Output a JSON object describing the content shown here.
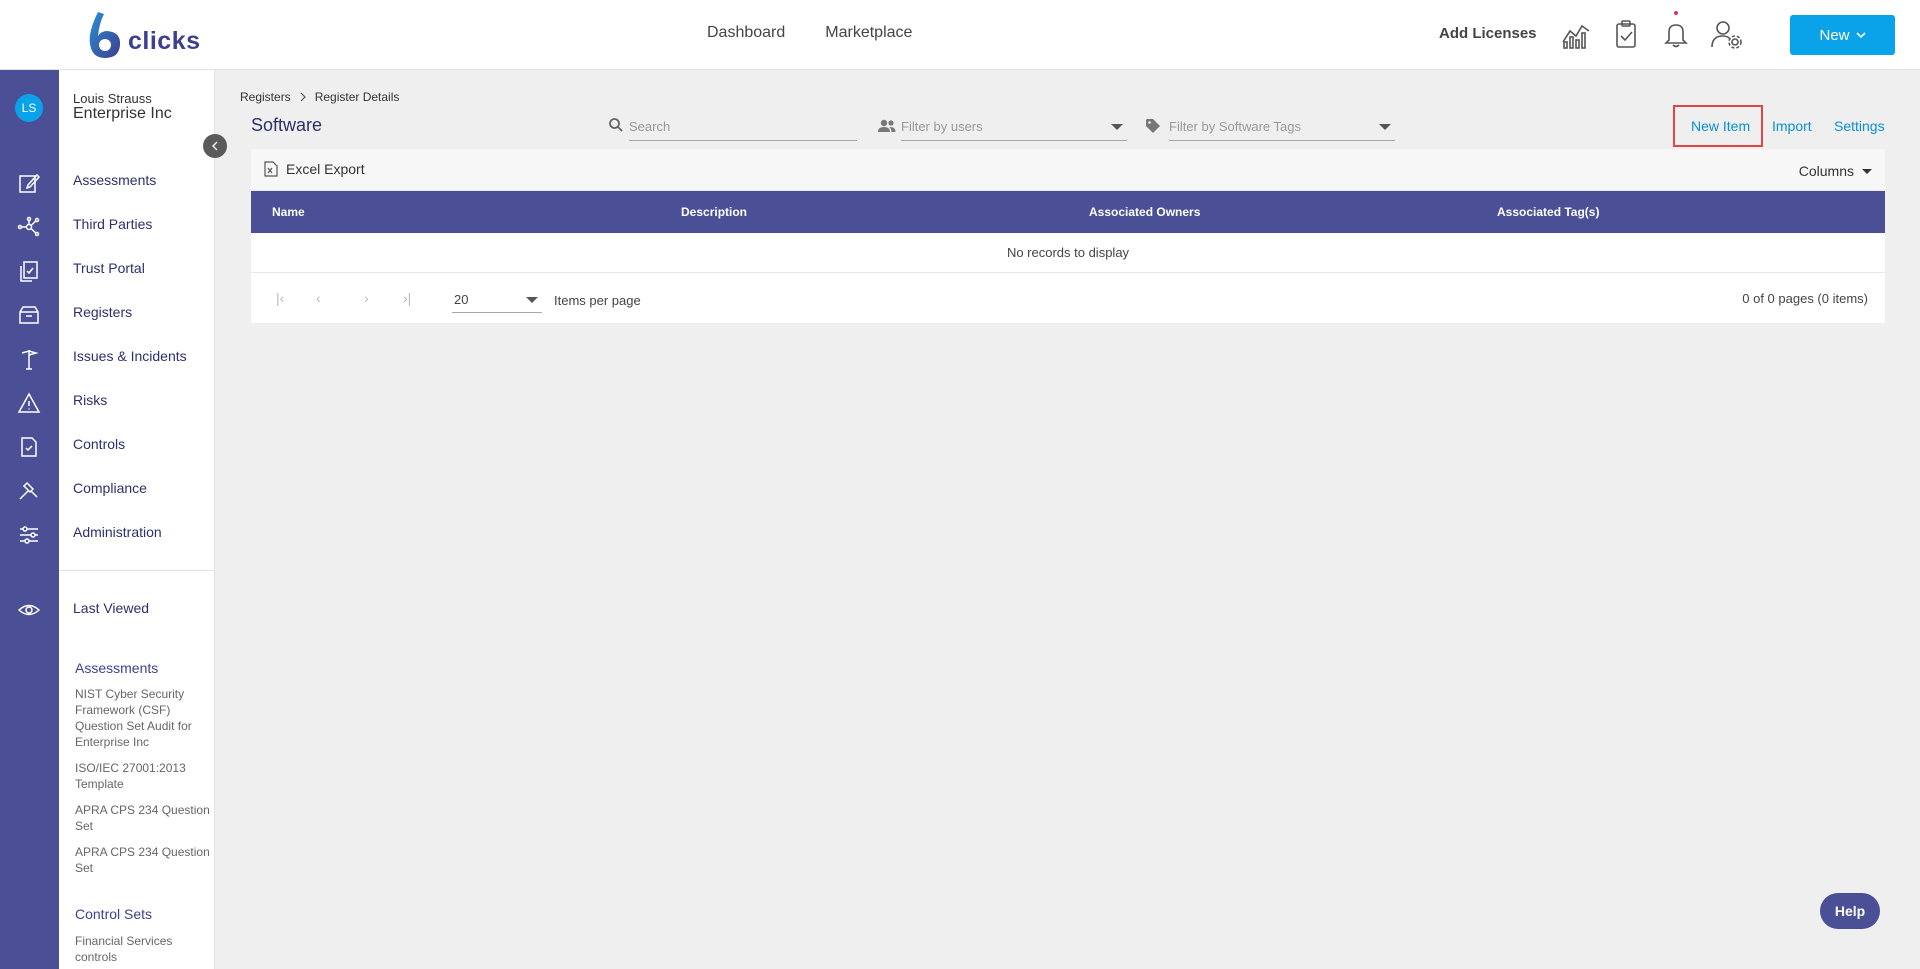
{
  "app": {
    "logo_text": "clicks",
    "brand_color": "#4a4f96",
    "accent_color": "#0aa2e8"
  },
  "topnav": {
    "links": [
      "Dashboard",
      "Marketplace"
    ],
    "add_licenses": "Add Licenses",
    "icons": [
      "analytics-icon",
      "clipboard-check-icon",
      "bell-icon",
      "user-settings-icon"
    ],
    "new_button": "New"
  },
  "user": {
    "initials": "LS",
    "name": "Louis Strauss",
    "org": "Enterprise Inc"
  },
  "sidebar": {
    "items": [
      {
        "label": "Assessments",
        "icon": "edit-icon"
      },
      {
        "label": "Third Parties",
        "icon": "network-icon"
      },
      {
        "label": "Trust Portal",
        "icon": "document-stack-icon"
      },
      {
        "label": "Registers",
        "icon": "archive-icon"
      },
      {
        "label": "Issues & Incidents",
        "icon": "signpost-icon"
      },
      {
        "label": "Risks",
        "icon": "warning-icon"
      },
      {
        "label": "Controls",
        "icon": "checklist-icon"
      },
      {
        "label": "Compliance",
        "icon": "gavel-icon"
      },
      {
        "label": "Administration",
        "icon": "sliders-icon"
      }
    ],
    "last_viewed": "Last Viewed",
    "sections": [
      {
        "title": "Assessments",
        "items": [
          "NIST Cyber Security Framework (CSF) Question Set Audit for Enterprise Inc",
          "ISO/IEC 27001:2013 Template",
          "APRA CPS 234 Question Set",
          "APRA CPS 234 Question Set"
        ]
      },
      {
        "title": "Control Sets",
        "items": [
          "Financial Services controls"
        ]
      }
    ]
  },
  "breadcrumb": {
    "root": "Registers",
    "current": "Register Details"
  },
  "page": {
    "title": "Software",
    "search_placeholder": "Search",
    "filter_users_placeholder": "Filter by users",
    "filter_tags_placeholder": "Filter by Software Tags",
    "actions": {
      "new_item": "New Item",
      "import": "Import",
      "settings": "Settings"
    }
  },
  "grid": {
    "excel_export": "Excel Export",
    "columns_label": "Columns",
    "headers": [
      "Name",
      "Description",
      "Associated Owners",
      "Associated Tag(s)"
    ],
    "empty_text": "No records to display",
    "page_size": "20",
    "items_per_page": "Items per page",
    "page_info": "0 of 0 pages (0 items)"
  },
  "help": "Help"
}
